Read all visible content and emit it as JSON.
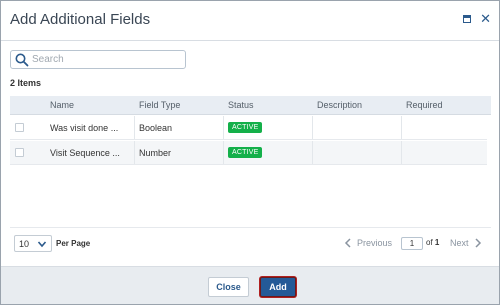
{
  "dialog": {
    "title": "Add Additional Fields",
    "maximize_icon": "maximize-icon",
    "close_icon": "close-icon"
  },
  "search": {
    "placeholder": "Search",
    "value": ""
  },
  "items_count": "2 Items",
  "table": {
    "columns": [
      "Name",
      "Field Type",
      "Status",
      "Description",
      "Required"
    ],
    "rows": [
      {
        "name": "Was visit done ...",
        "field_type": "Boolean",
        "status": "ACTIVE",
        "description": "",
        "required": ""
      },
      {
        "name": "Visit Sequence ...",
        "field_type": "Number",
        "status": "ACTIVE",
        "description": "",
        "required": ""
      }
    ]
  },
  "pager": {
    "per_page_value": "10",
    "per_page_label": "Per Page",
    "previous": "Previous",
    "page_value": "1",
    "of_label": "of",
    "total_pages": "1",
    "next": "Next"
  },
  "footer": {
    "close_label": "Close",
    "add_label": "Add"
  },
  "colors": {
    "accent": "#245a97",
    "active_badge": "#14b04a",
    "header_bg": "#e8edf3"
  }
}
